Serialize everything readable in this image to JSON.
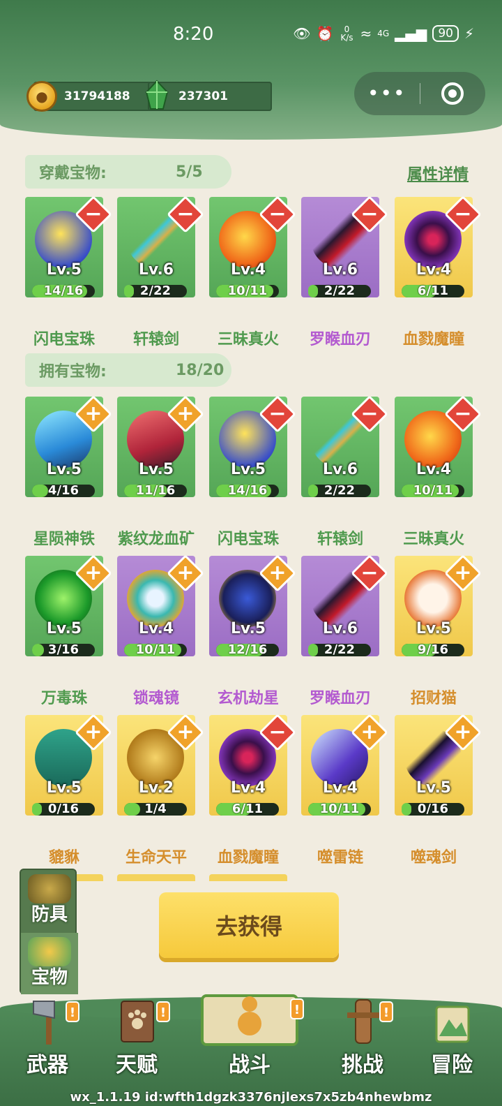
{
  "status_bar": {
    "time": "8:20",
    "net_speed": "0 K/s",
    "signal": "4G",
    "wifi": "6",
    "battery": "90"
  },
  "currency": {
    "coins": "31794188",
    "gems": "237301"
  },
  "equipped": {
    "label": "穿戴宝物:",
    "count": "5/5",
    "detail_link": "属性详情",
    "items": [
      {
        "name": "闪电宝珠",
        "level": "Lv.5",
        "progress": "14/16",
        "progress_value": 0.875,
        "rarity": "green",
        "action": "minus",
        "icon": "lightning-orb-icon"
      },
      {
        "name": "轩辕剑",
        "level": "Lv.6",
        "progress": "2/22",
        "progress_value": 0.09,
        "rarity": "green",
        "action": "minus",
        "icon": "jade-sword-icon"
      },
      {
        "name": "三昧真火",
        "level": "Lv.4",
        "progress": "10/11",
        "progress_value": 0.91,
        "rarity": "green",
        "action": "minus",
        "icon": "fire-orb-icon"
      },
      {
        "name": "罗睺血刃",
        "level": "Lv.6",
        "progress": "2/22",
        "progress_value": 0.09,
        "rarity": "purple",
        "action": "minus",
        "icon": "blood-blade-icon"
      },
      {
        "name": "血戮魔瞳",
        "level": "Lv.4",
        "progress": "6/11",
        "progress_value": 0.55,
        "rarity": "gold",
        "action": "minus",
        "icon": "demon-eye-icon"
      }
    ]
  },
  "owned": {
    "label": "拥有宝物:",
    "count": "18/20",
    "items": [
      {
        "name": "星陨神铁",
        "level": "Lv.5",
        "progress": "4/16",
        "progress_value": 0.25,
        "rarity": "green",
        "action": "plus",
        "icon": "blue-crystal-icon"
      },
      {
        "name": "紫纹龙血矿",
        "level": "Lv.5",
        "progress": "11/16",
        "progress_value": 0.69,
        "rarity": "green",
        "action": "plus",
        "icon": "red-crystal-icon"
      },
      {
        "name": "闪电宝珠",
        "level": "Lv.5",
        "progress": "14/16",
        "progress_value": 0.875,
        "rarity": "green",
        "action": "minus",
        "icon": "lightning-orb-icon"
      },
      {
        "name": "轩辕剑",
        "level": "Lv.6",
        "progress": "2/22",
        "progress_value": 0.09,
        "rarity": "green",
        "action": "minus",
        "icon": "jade-sword-icon"
      },
      {
        "name": "三昧真火",
        "level": "Lv.4",
        "progress": "10/11",
        "progress_value": 0.91,
        "rarity": "green",
        "action": "minus",
        "icon": "fire-orb-icon"
      },
      {
        "name": "万毒珠",
        "level": "Lv.5",
        "progress": "3/16",
        "progress_value": 0.19,
        "rarity": "green",
        "action": "plus",
        "icon": "poison-orb-icon"
      },
      {
        "name": "锁魂镜",
        "level": "Lv.4",
        "progress": "10/11",
        "progress_value": 0.91,
        "rarity": "purple",
        "action": "plus",
        "icon": "soul-mirror-icon"
      },
      {
        "name": "玄机劫星",
        "level": "Lv.5",
        "progress": "12/16",
        "progress_value": 0.75,
        "rarity": "purple",
        "action": "plus",
        "icon": "dark-star-icon"
      },
      {
        "name": "罗睺血刃",
        "level": "Lv.6",
        "progress": "2/22",
        "progress_value": 0.09,
        "rarity": "purple",
        "action": "minus",
        "icon": "blood-blade-icon"
      },
      {
        "name": "招财猫",
        "level": "Lv.5",
        "progress": "9/16",
        "progress_value": 0.56,
        "rarity": "gold",
        "action": "plus",
        "icon": "lucky-cat-icon"
      },
      {
        "name": "貔貅",
        "level": "Lv.5",
        "progress": "0/16",
        "progress_value": 0.0,
        "rarity": "gold",
        "action": "plus",
        "icon": "pixiu-statue-icon"
      },
      {
        "name": "生命天平",
        "level": "Lv.2",
        "progress": "1/4",
        "progress_value": 0.25,
        "rarity": "gold",
        "action": "plus",
        "icon": "golden-scale-icon"
      },
      {
        "name": "血戮魔瞳",
        "level": "Lv.4",
        "progress": "6/11",
        "progress_value": 0.55,
        "rarity": "gold",
        "action": "minus",
        "icon": "demon-eye-icon"
      },
      {
        "name": "噬雷链",
        "level": "Lv.4",
        "progress": "10/11",
        "progress_value": 0.91,
        "rarity": "gold",
        "action": "plus",
        "icon": "thunder-chain-icon"
      },
      {
        "name": "噬魂剑",
        "level": "Lv.5",
        "progress": "0/16",
        "progress_value": 0.0,
        "rarity": "gold",
        "action": "plus",
        "icon": "soul-sword-icon"
      }
    ]
  },
  "colors": {
    "green": "#5fb25e",
    "purple": "#a77ccc",
    "gold": "#f4d35c",
    "minus": "#e2453a",
    "plus": "#f0a22a"
  },
  "side_tabs": [
    "防具",
    "宝物"
  ],
  "get_button": "去获得",
  "nav": {
    "weapon": "武器",
    "talent": "天赋",
    "battle": "战斗",
    "challenge": "挑战",
    "adventure": "冒险",
    "alert_mark": "!"
  },
  "footer_id": "wx_1.1.19 id:wfth1dgzk3376njlexs7x5zb4nhewbmz"
}
